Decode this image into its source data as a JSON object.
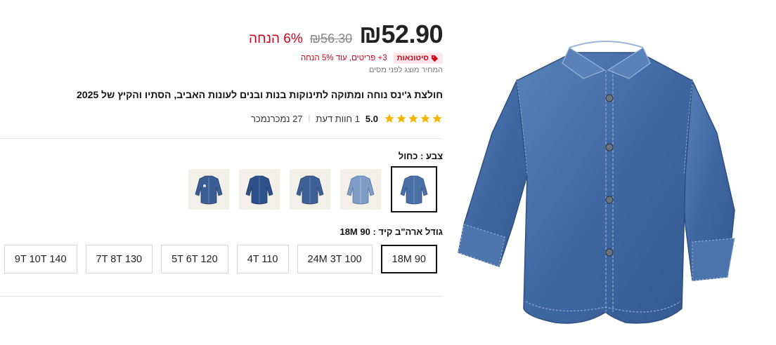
{
  "price": {
    "current": "₪52.90",
    "original": "₪56.30",
    "discount": "6% הנחה"
  },
  "wholesale": {
    "badge": "סיטונאות",
    "text": "3+ פריטים, עוד 5% הנחה"
  },
  "tax_note": "המחיר מוצג לפני מסים",
  "title": "חולצת ג'ינס נוחה ומתוקה לתינוקות בנות ובנים לעונות האביב, הסתיו והקיץ של 2025",
  "rating": {
    "stars": 5,
    "score": "5.0",
    "reviews": "1 חוות דעת",
    "sold": "27 נמכרנמכר"
  },
  "color": {
    "label": "צבע : כחול",
    "thumbnail_count": 5,
    "selected_index": 0
  },
  "size": {
    "label": "גודל ארה\"ב קיד : 18M 90",
    "options": [
      "18M 90",
      "24M 3T 100",
      "4T 110",
      "5T 6T 120",
      "7T 8T 130",
      "9T 10T 140"
    ],
    "selected_index": 0
  },
  "colors": {
    "accent_red": "#d0021b",
    "star": "#f5b400",
    "denim": "#4a6fa5"
  }
}
